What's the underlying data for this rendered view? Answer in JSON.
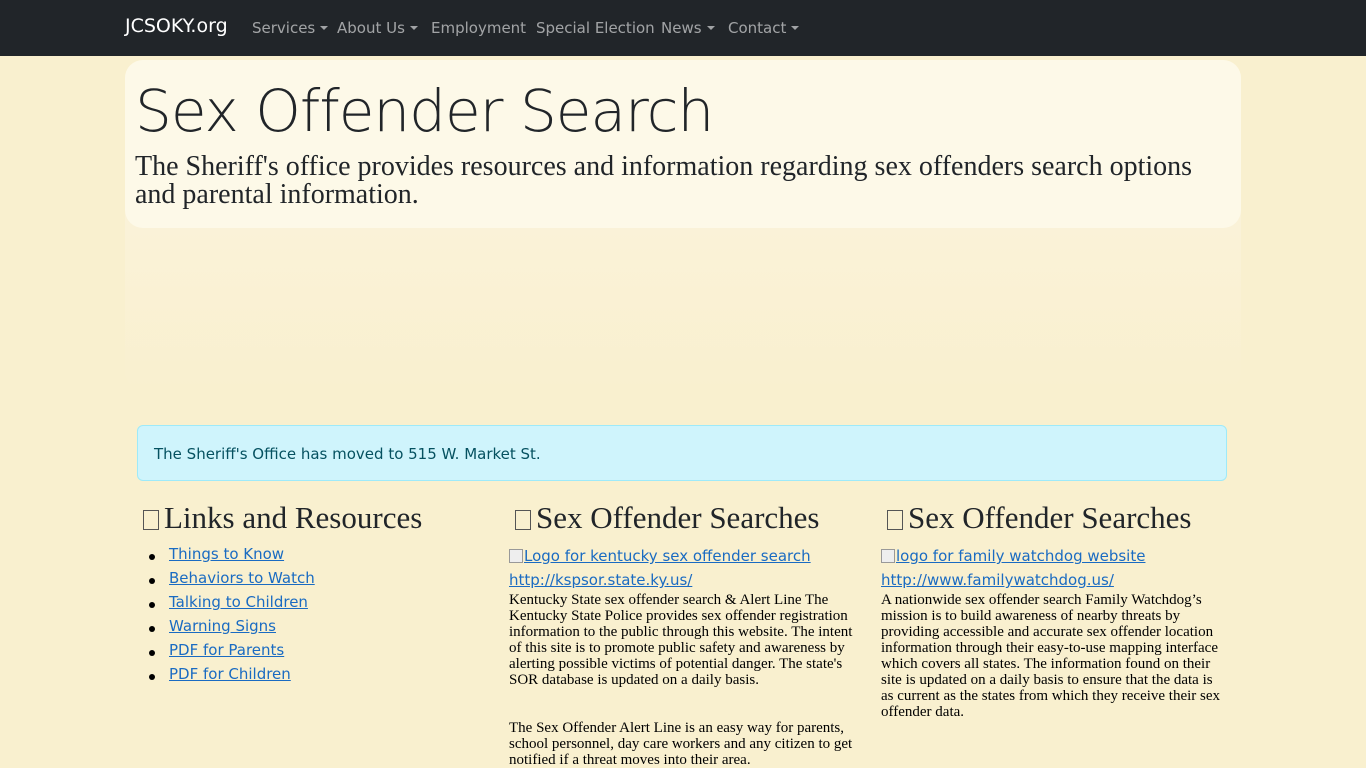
{
  "navbar": {
    "brand": "JCSOKY.org",
    "items": [
      {
        "label": "Services",
        "dropdown": true
      },
      {
        "label": "About Us",
        "dropdown": true
      },
      {
        "label": "Employment",
        "dropdown": false
      },
      {
        "label": "Special Election",
        "dropdown": false
      },
      {
        "label": "News",
        "dropdown": true
      },
      {
        "label": "Contact",
        "dropdown": true
      }
    ]
  },
  "hero": {
    "title": "Sex Offender Search",
    "lead": "The Sheriff's office provides resources and information regarding sex offenders search options and parental information."
  },
  "alert": {
    "text": "The Sheriff's Office has moved to 515 W. Market St."
  },
  "columns": {
    "resources": {
      "heading": "Links and Resources",
      "links": [
        "Things to Know",
        "Behaviors to Watch",
        "Talking to Children",
        "Warning Signs",
        "PDF for Parents",
        "PDF for Children"
      ]
    },
    "kentucky": {
      "heading": "Sex Offender Searches",
      "image_alt": "Logo for kentucky sex offender search",
      "url": "http://kspsor.state.ky.us/",
      "paragraph1": "Kentucky State sex offender search & Alert Line The Kentucky State Police provides sex offender registration information to the public through this website. The intent of this site is to promote public safety and awareness by alerting possible victims of potential danger. The state's SOR database is updated on a daily basis.",
      "paragraph2": "The Sex Offender Alert Line is an easy way for parents, school personnel, day care workers and any citizen to get notified if a threat moves into their area."
    },
    "watchdog": {
      "heading": "Sex Offender Searches",
      "image_alt": "logo for family watchdog website",
      "url": "http://www.familywatchdog.us/",
      "paragraph": "A nationwide sex offender search Family Watchdog’s mission is to build awareness of nearby threats by providing accessible and accurate sex offender location information through their easy-to-use mapping interface which covers all states. The information found on their site is updated on a daily basis to ensure that the data is as current as the states from which they receive their sex offender data."
    }
  },
  "colors": {
    "navbar_bg": "#212529",
    "page_bg": "#f9f0cf",
    "jumbotron_bg": "#fdf9e8",
    "alert_bg": "#cff4fc",
    "alert_text": "#055160",
    "link": "#1a6bc2"
  }
}
